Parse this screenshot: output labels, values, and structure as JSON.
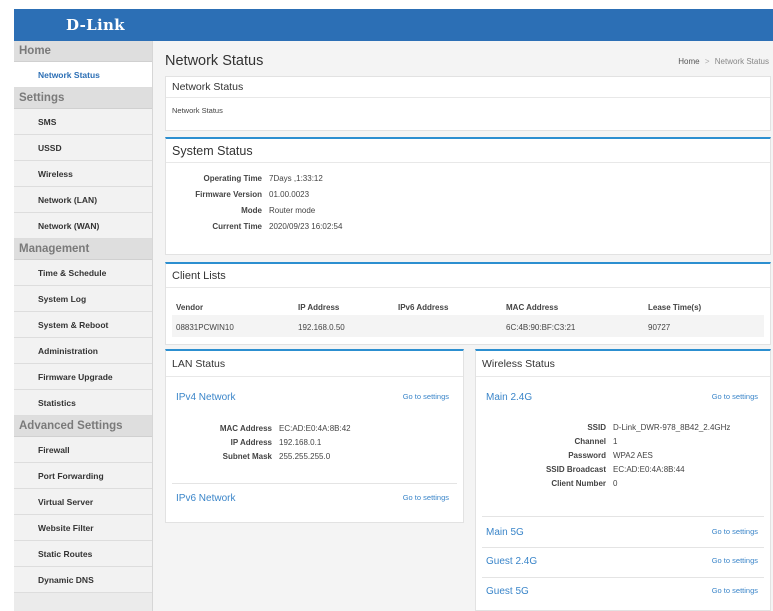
{
  "brand": {
    "logo": "D-Link"
  },
  "sidebar": {
    "sections": [
      {
        "title": "Home",
        "items": [
          "Network Status"
        ]
      },
      {
        "title": "Settings",
        "items": [
          "SMS",
          "USSD",
          "Wireless",
          "Network (LAN)",
          "Network (WAN)"
        ]
      },
      {
        "title": "Management",
        "items": [
          "Time & Schedule",
          "System Log",
          "System & Reboot",
          "Administration",
          "Firmware Upgrade",
          "Statistics"
        ]
      },
      {
        "title": "Advanced Settings",
        "items": [
          "Firewall",
          "Port Forwarding",
          "Virtual Server",
          "Website Filter",
          "Static Routes",
          "Dynamic DNS"
        ]
      }
    ],
    "active_item": "Network Status"
  },
  "header": {
    "title": "Network Status",
    "breadcrumb_home": "Home",
    "breadcrumb_sep": ">",
    "breadcrumb_current": "Network Status"
  },
  "network_status_panel": {
    "title": "Network Status",
    "body": "Network Status"
  },
  "system_status": {
    "title": "System Status",
    "rows": [
      {
        "label": "Operating Time",
        "value": "7Days ,1:33:12"
      },
      {
        "label": "Firmware Version",
        "value": "01.00.0023"
      },
      {
        "label": "Mode",
        "value": "Router mode"
      },
      {
        "label": "Current Time",
        "value": "2020/09/23 16:02:54"
      }
    ]
  },
  "client_lists": {
    "title": "Client Lists",
    "headers": {
      "vendor": "Vendor",
      "ip": "IP Address",
      "ipv6": "IPv6 Address",
      "mac": "MAC Address",
      "lease": "Lease Time(s)"
    },
    "row": {
      "vendor": "08831PCWIN10",
      "ip": "192.168.0.50",
      "ipv6": "",
      "mac": "6C:4B:90:BF:C3:21",
      "lease": "90727"
    }
  },
  "lan_status": {
    "title": "LAN Status",
    "ipv4_title": "IPv4 Network",
    "ipv6_title": "IPv6 Network",
    "go_to_settings": "Go to settings",
    "rows": [
      {
        "label": "MAC Address",
        "value": "EC:AD:E0:4A:8B:42"
      },
      {
        "label": "IP Address",
        "value": "192.168.0.1"
      },
      {
        "label": "Subnet Mask",
        "value": "255.255.255.0"
      }
    ]
  },
  "wireless_status": {
    "title": "Wireless Status",
    "go_to_settings": "Go to settings",
    "main24_title": "Main 2.4G",
    "main5_title": "Main 5G",
    "guest24_title": "Guest 2.4G",
    "guest5_title": "Guest 5G",
    "rows": [
      {
        "label": "SSID",
        "value": "D-Link_DWR-978_8B42_2.4GHz"
      },
      {
        "label": "Channel",
        "value": "1"
      },
      {
        "label": "Password",
        "value": "WPA2 AES"
      },
      {
        "label": "SSID Broadcast",
        "value": "EC:AD:E0:4A:8B:44"
      },
      {
        "label": "Client Number",
        "value": "0"
      }
    ]
  },
  "colors": {
    "brand_blue": "#2c6fb5",
    "accent_blue": "#2c8fd0",
    "link_blue": "#3a85c9"
  }
}
